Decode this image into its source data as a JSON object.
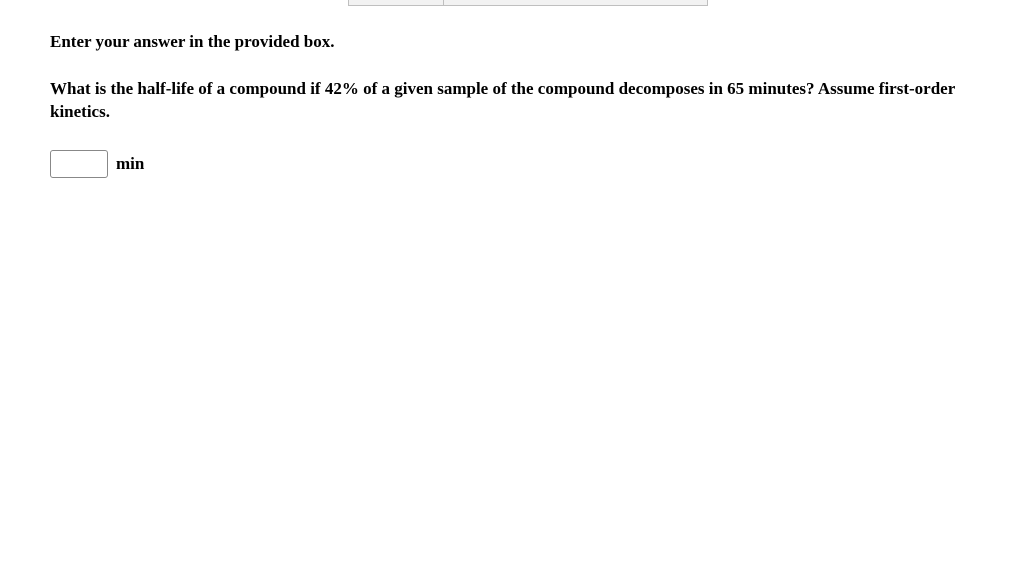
{
  "instruction": "Enter your answer in the provided box.",
  "question": "What is the half-life of a compound if 42% of a given sample of the compound decomposes in 65 minutes? Assume first-order kinetics.",
  "answer": {
    "value": "",
    "unit": "min"
  }
}
